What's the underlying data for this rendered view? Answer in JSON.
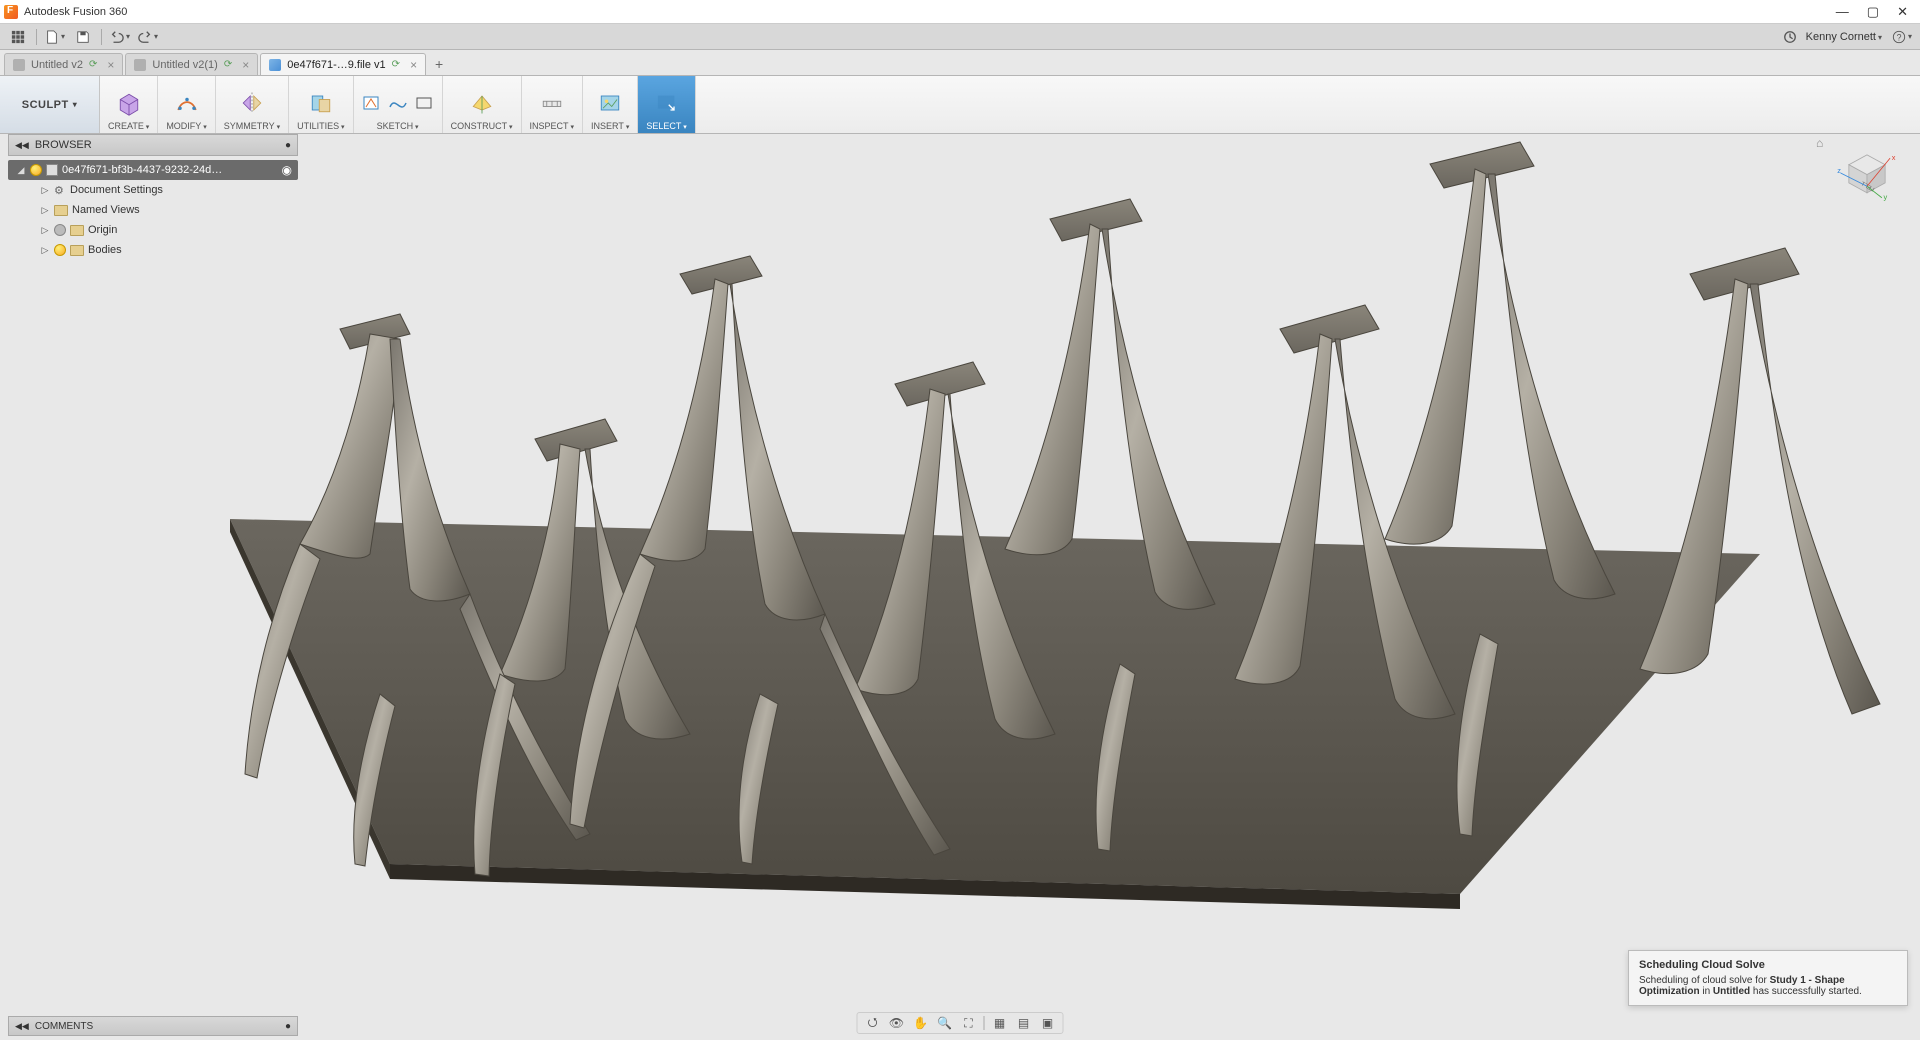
{
  "app": {
    "title": "Autodesk Fusion 360"
  },
  "user": {
    "name": "Kenny Cornett"
  },
  "qat": {
    "grid": "grid",
    "file": "file",
    "save": "save",
    "undo": "undo",
    "redo": "redo",
    "recent": "recent",
    "help": "?"
  },
  "tabs": [
    {
      "label": "Untitled v2",
      "active": false
    },
    {
      "label": "Untitled v2(1)",
      "active": false
    },
    {
      "label": "0e47f671-…9.file v1",
      "active": true
    }
  ],
  "workspace": {
    "label": "SCULPT"
  },
  "toolbar": [
    {
      "id": "create",
      "label": "CREATE"
    },
    {
      "id": "modify",
      "label": "MODIFY"
    },
    {
      "id": "symmetry",
      "label": "SYMMETRY"
    },
    {
      "id": "utilities",
      "label": "UTILITIES"
    },
    {
      "id": "sketch",
      "label": "SKETCH"
    },
    {
      "id": "construct",
      "label": "CONSTRUCT"
    },
    {
      "id": "inspect",
      "label": "INSPECT"
    },
    {
      "id": "insert",
      "label": "INSERT"
    },
    {
      "id": "select",
      "label": "SELECT",
      "selected": true
    }
  ],
  "browser": {
    "title": "BROWSER",
    "root": "0e47f671-bf3b-4437-9232-24d…",
    "items": [
      {
        "label": "Document Settings",
        "icon": "gear"
      },
      {
        "label": "Named Views",
        "icon": "folder"
      },
      {
        "label": "Origin",
        "icon": "folder",
        "bulb": true
      },
      {
        "label": "Bodies",
        "icon": "folder",
        "bulb": true
      }
    ]
  },
  "comments": {
    "title": "COMMENTS"
  },
  "viewcube": {
    "face": "LEFT",
    "axes": {
      "x": "x",
      "y": "y",
      "z": "z"
    }
  },
  "notification": {
    "title": "Scheduling Cloud Solve",
    "pre": "Scheduling of cloud solve for ",
    "study": "Study 1 - Shape Optimization",
    "mid": " in ",
    "doc": "Untitled",
    "post": " has successfully started."
  }
}
